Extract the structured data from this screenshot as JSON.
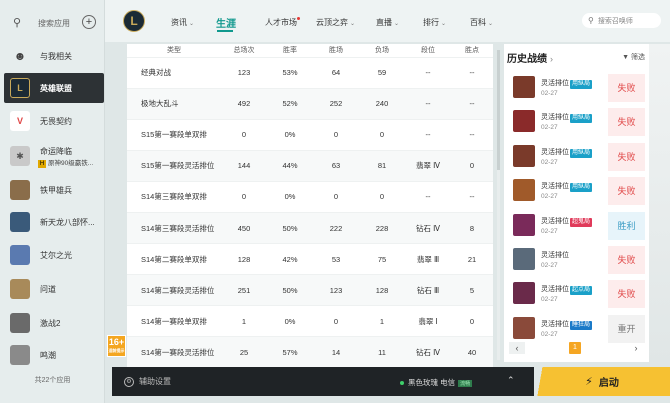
{
  "sidebar": {
    "search_label": "搜索应用",
    "items": [
      {
        "label": "与我相关",
        "icon": "user-icon",
        "color": "#e6eded"
      },
      {
        "label": "英雄联盟",
        "icon": "lol-logo",
        "color": "#1b2a35"
      },
      {
        "label": "无畏契约",
        "icon": "valorant-logo",
        "color": "#f0f0f0"
      },
      {
        "label": "命运降临",
        "icon": "game-logo",
        "color": "#c9c9c9"
      },
      {
        "label": "铁甲雄兵",
        "icon": "game-logo",
        "color": "#8a6d4a"
      },
      {
        "label": "新天龙八部怀...",
        "icon": "game-logo",
        "color": "#3a5a7a"
      },
      {
        "label": "艾尔之光",
        "icon": "game-logo",
        "color": "#5a7ab0"
      },
      {
        "label": "问道",
        "icon": "game-logo",
        "color": "#a88a5a"
      },
      {
        "label": "激战2",
        "icon": "game-logo",
        "color": "#6a6a6a"
      },
      {
        "label": "鸣潮",
        "icon": "game-logo",
        "color": "#8a8a8a"
      }
    ],
    "promo_sub": "原神90级赢铁...",
    "footer": "共22个应用",
    "age_rating": "16+",
    "age_sub": "适龄提示"
  },
  "topnav": {
    "logo": "L",
    "items": [
      {
        "label": "资讯",
        "caret": "⌄"
      },
      {
        "label": "生涯",
        "caret": ""
      },
      {
        "label": "人才市场",
        "caret": ""
      },
      {
        "label": "云顶之弈",
        "caret": "⌄"
      },
      {
        "label": "直播",
        "caret": "⌄"
      },
      {
        "label": "排行",
        "caret": "⌄"
      },
      {
        "label": "百科",
        "caret": "⌄"
      }
    ],
    "search_placeholder": "搜索召唤师"
  },
  "table": {
    "headers": [
      "类型",
      "总场次",
      "胜率",
      "胜场",
      "负场",
      "段位",
      "胜点"
    ],
    "rows": [
      [
        "经典对战",
        "123",
        "53%",
        "64",
        "59",
        "--",
        "--"
      ],
      [
        "极地大乱斗",
        "492",
        "52%",
        "252",
        "240",
        "--",
        "--"
      ],
      [
        "S15第一赛段单双排",
        "0",
        "0%",
        "0",
        "0",
        "--",
        "--"
      ],
      [
        "S15第一赛段灵活排位",
        "144",
        "44%",
        "63",
        "81",
        "翡翠 Ⅳ",
        "0"
      ],
      [
        "S14第三赛段单双排",
        "0",
        "0%",
        "0",
        "0",
        "--",
        "--"
      ],
      [
        "S14第三赛段灵活排位",
        "450",
        "50%",
        "222",
        "228",
        "钻石 Ⅳ",
        "8"
      ],
      [
        "S14第二赛段单双排",
        "128",
        "42%",
        "53",
        "75",
        "翡翠 Ⅲ",
        "21"
      ],
      [
        "S14第二赛段灵活排位",
        "251",
        "50%",
        "123",
        "128",
        "钻石 Ⅲ",
        "5"
      ],
      [
        "S14第一赛段单双排",
        "1",
        "0%",
        "0",
        "1",
        "翡翠 Ⅰ",
        "0"
      ],
      [
        "S14第一赛段灵活排位",
        "25",
        "57%",
        "14",
        "11",
        "钻石 Ⅳ",
        "40"
      ]
    ]
  },
  "history": {
    "title": "历史战绩",
    "arrow": "›",
    "filter": "筛选",
    "matches": [
      {
        "mode": "灵活排位",
        "tag": "用纵局",
        "tag_color": "#1aa0c8",
        "date": "02-27",
        "result": "失败",
        "type": "lose",
        "champ_color": "#7a3a2a"
      },
      {
        "mode": "灵活排位",
        "tag": "用纵局",
        "tag_color": "#1aa0c8",
        "date": "02-27",
        "result": "失败",
        "type": "lose",
        "champ_color": "#8a2a2a"
      },
      {
        "mode": "灵活排位",
        "tag": "用纵局",
        "tag_color": "#1aa0c8",
        "date": "02-27",
        "result": "失败",
        "type": "lose",
        "champ_color": "#7a3a2a"
      },
      {
        "mode": "灵活排位",
        "tag": "用纵局",
        "tag_color": "#1aa0c8",
        "date": "02-27",
        "result": "失败",
        "type": "lose",
        "champ_color": "#a05a2a"
      },
      {
        "mode": "灵活排位",
        "tag": "超鬼局",
        "tag_color": "#e03a5a",
        "date": "02-27",
        "result": "胜利",
        "type": "win",
        "champ_color": "#7a2a5a"
      },
      {
        "mode": "灵活排位",
        "tag": "",
        "tag_color": "",
        "date": "02-27",
        "result": "失败",
        "type": "lose",
        "champ_color": "#5a6a7a"
      },
      {
        "mode": "灵活排位",
        "tag": "起点局",
        "tag_color": "#1aa0c8",
        "date": "02-27",
        "result": "失败",
        "type": "lose",
        "champ_color": "#6a2a4a"
      },
      {
        "mode": "灵活排位",
        "tag": "睡狂局",
        "tag_color": "#1a7ac8",
        "date": "02-27",
        "result": "重开",
        "type": "remake",
        "champ_color": "#8a4a3a"
      }
    ],
    "prev": "‹",
    "page": "1",
    "next": "›"
  },
  "bottombar": {
    "assist_label": "辅助设置",
    "server": "黑色玫瑰 电信",
    "server_badge": "流畅",
    "up_arrow": "⌃",
    "launch_label": "启动",
    "launch_icon": "⚡"
  }
}
